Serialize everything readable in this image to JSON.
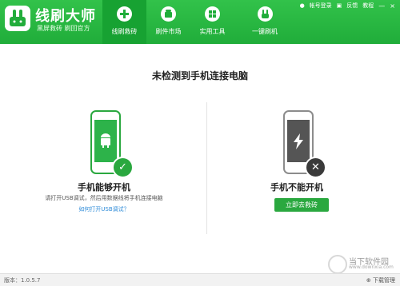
{
  "header": {
    "app_title": "线刷大师",
    "app_subtitle": "黑屏救砖 刷回官方",
    "tabs": [
      {
        "label": "线刷救砖",
        "icon": "plus-icon"
      },
      {
        "label": "刷件市场",
        "icon": "robot-icon"
      },
      {
        "label": "实用工具",
        "icon": "grid-icon"
      },
      {
        "label": "一键刷机",
        "icon": "rabbit-icon"
      }
    ],
    "account_label": "帐号登录",
    "feedback_label": "反馈",
    "tutorial_label": "教程",
    "window_controls": [
      "—",
      "×"
    ]
  },
  "main": {
    "title": "未检测到手机连接电脑",
    "left": {
      "title": "手机能够开机",
      "hint": "请打开USB调试，然后用数据线将手机连接电脑",
      "link": "如何打开USB调试？"
    },
    "right": {
      "title": "手机不能开机",
      "button": "立即去救砖"
    }
  },
  "footer": {
    "version": "版本：1.0.5.7",
    "download_manager": "下载管理"
  },
  "watermark": {
    "text": "当下软件园",
    "url": "www.downxia.com"
  },
  "colors": {
    "brand_green": "#2aa83f",
    "header_green": "#20ad3a",
    "link_blue": "#2e8bd8"
  }
}
